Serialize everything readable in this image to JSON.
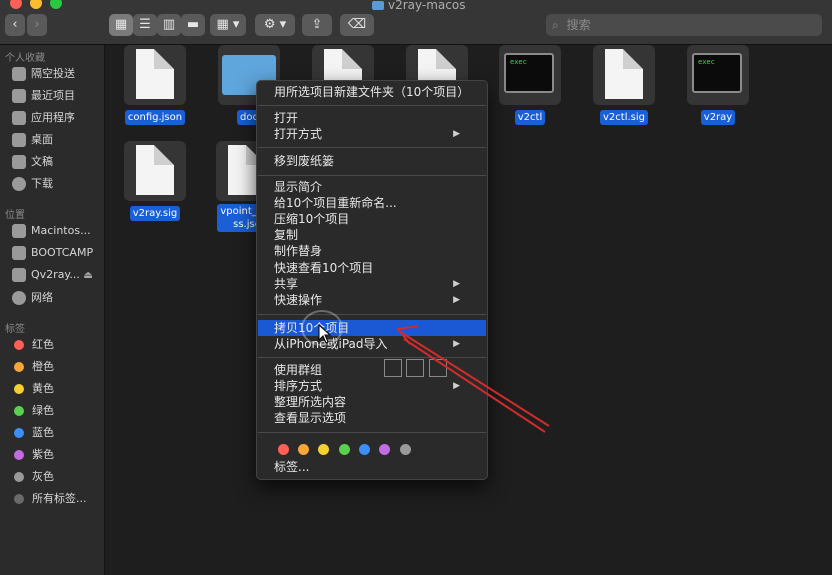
{
  "window": {
    "title": "v2ray-macos"
  },
  "toolbar": {
    "back": "‹",
    "forward": "›",
    "view_icon": "▦",
    "view_list": "☰",
    "view_columns": "▥",
    "view_gallery": "▬",
    "group": "▦ ▾",
    "action": "⚙ ▾",
    "share": "⇪",
    "tag": "⌫",
    "search_placeholder": "搜索"
  },
  "sidebar": {
    "favorites_header": "个人收藏",
    "favorites": [
      {
        "label": "隔空投送",
        "icon": "airdrop-icon"
      },
      {
        "label": "最近项目",
        "icon": "recents-icon"
      },
      {
        "label": "应用程序",
        "icon": "applications-icon"
      },
      {
        "label": "桌面",
        "icon": "desktop-icon"
      },
      {
        "label": "文稿",
        "icon": "documents-icon"
      },
      {
        "label": "下载",
        "icon": "downloads-icon"
      }
    ],
    "locations_header": "位置",
    "locations": [
      {
        "label": "Macintos...",
        "icon": "disk-icon"
      },
      {
        "label": "BOOTCAMP",
        "icon": "disk-icon"
      },
      {
        "label": "Qv2ray...",
        "icon": "disk-icon",
        "eject": "⏏"
      },
      {
        "label": "网络",
        "icon": "network-icon"
      }
    ],
    "tags_header": "标签",
    "tags": [
      {
        "label": "红色",
        "color": "#ff5f57"
      },
      {
        "label": "橙色",
        "color": "#f7a63a"
      },
      {
        "label": "黄色",
        "color": "#f5d033"
      },
      {
        "label": "绿色",
        "color": "#5ad04f"
      },
      {
        "label": "蓝色",
        "color": "#3b8ff6"
      },
      {
        "label": "紫色",
        "color": "#c36be0"
      },
      {
        "label": "灰色",
        "color": "#9a9a9a"
      },
      {
        "label": "所有标签...",
        "color": "#6a6a6a"
      }
    ]
  },
  "files": [
    {
      "name": "config.json",
      "kind": "doc"
    },
    {
      "name": "doc",
      "kind": "folder"
    },
    {
      "name": "",
      "kind": "doc"
    },
    {
      "name": "",
      "kind": "doc"
    },
    {
      "name": "v2ctl",
      "kind": "exec",
      "exec_text": "exec"
    },
    {
      "name": "v2ctl.sig",
      "kind": "doc"
    },
    {
      "name": "v2ray",
      "kind": "exec",
      "exec_text": "exec"
    },
    {
      "name": "v2ray.sig",
      "kind": "doc"
    },
    {
      "name": "vpoint_soc",
      "name2": "ss.jso",
      "kind": "doc"
    }
  ],
  "context_menu": {
    "new_folder": "用所选项目新建文件夹（10个项目）",
    "open": "打开",
    "open_with": "打开方式",
    "trash": "移到废纸篓",
    "get_info": "显示简介",
    "rename": "给10个项目重新命名...",
    "compress": "压缩10个项目",
    "duplicate": "复制",
    "alias": "制作替身",
    "quicklook": "快速查看10个项目",
    "share": "共享",
    "quick_actions": "快速操作",
    "copy": "拷贝10个项目",
    "import": "从iPhone或iPad导入",
    "use_groups": "使用群组",
    "sort_by": "排序方式",
    "clean_up": "整理所选内容",
    "view_options": "查看显示选项",
    "tags_label": "标签...",
    "submenu_arrow": "▶",
    "tag_colors": [
      "#ff5f57",
      "#f7a63a",
      "#f5d033",
      "#5ad04f",
      "#3b8ff6",
      "#c36be0",
      "#9a9a9a"
    ]
  },
  "annotation": {
    "color": "#d22b2b"
  }
}
